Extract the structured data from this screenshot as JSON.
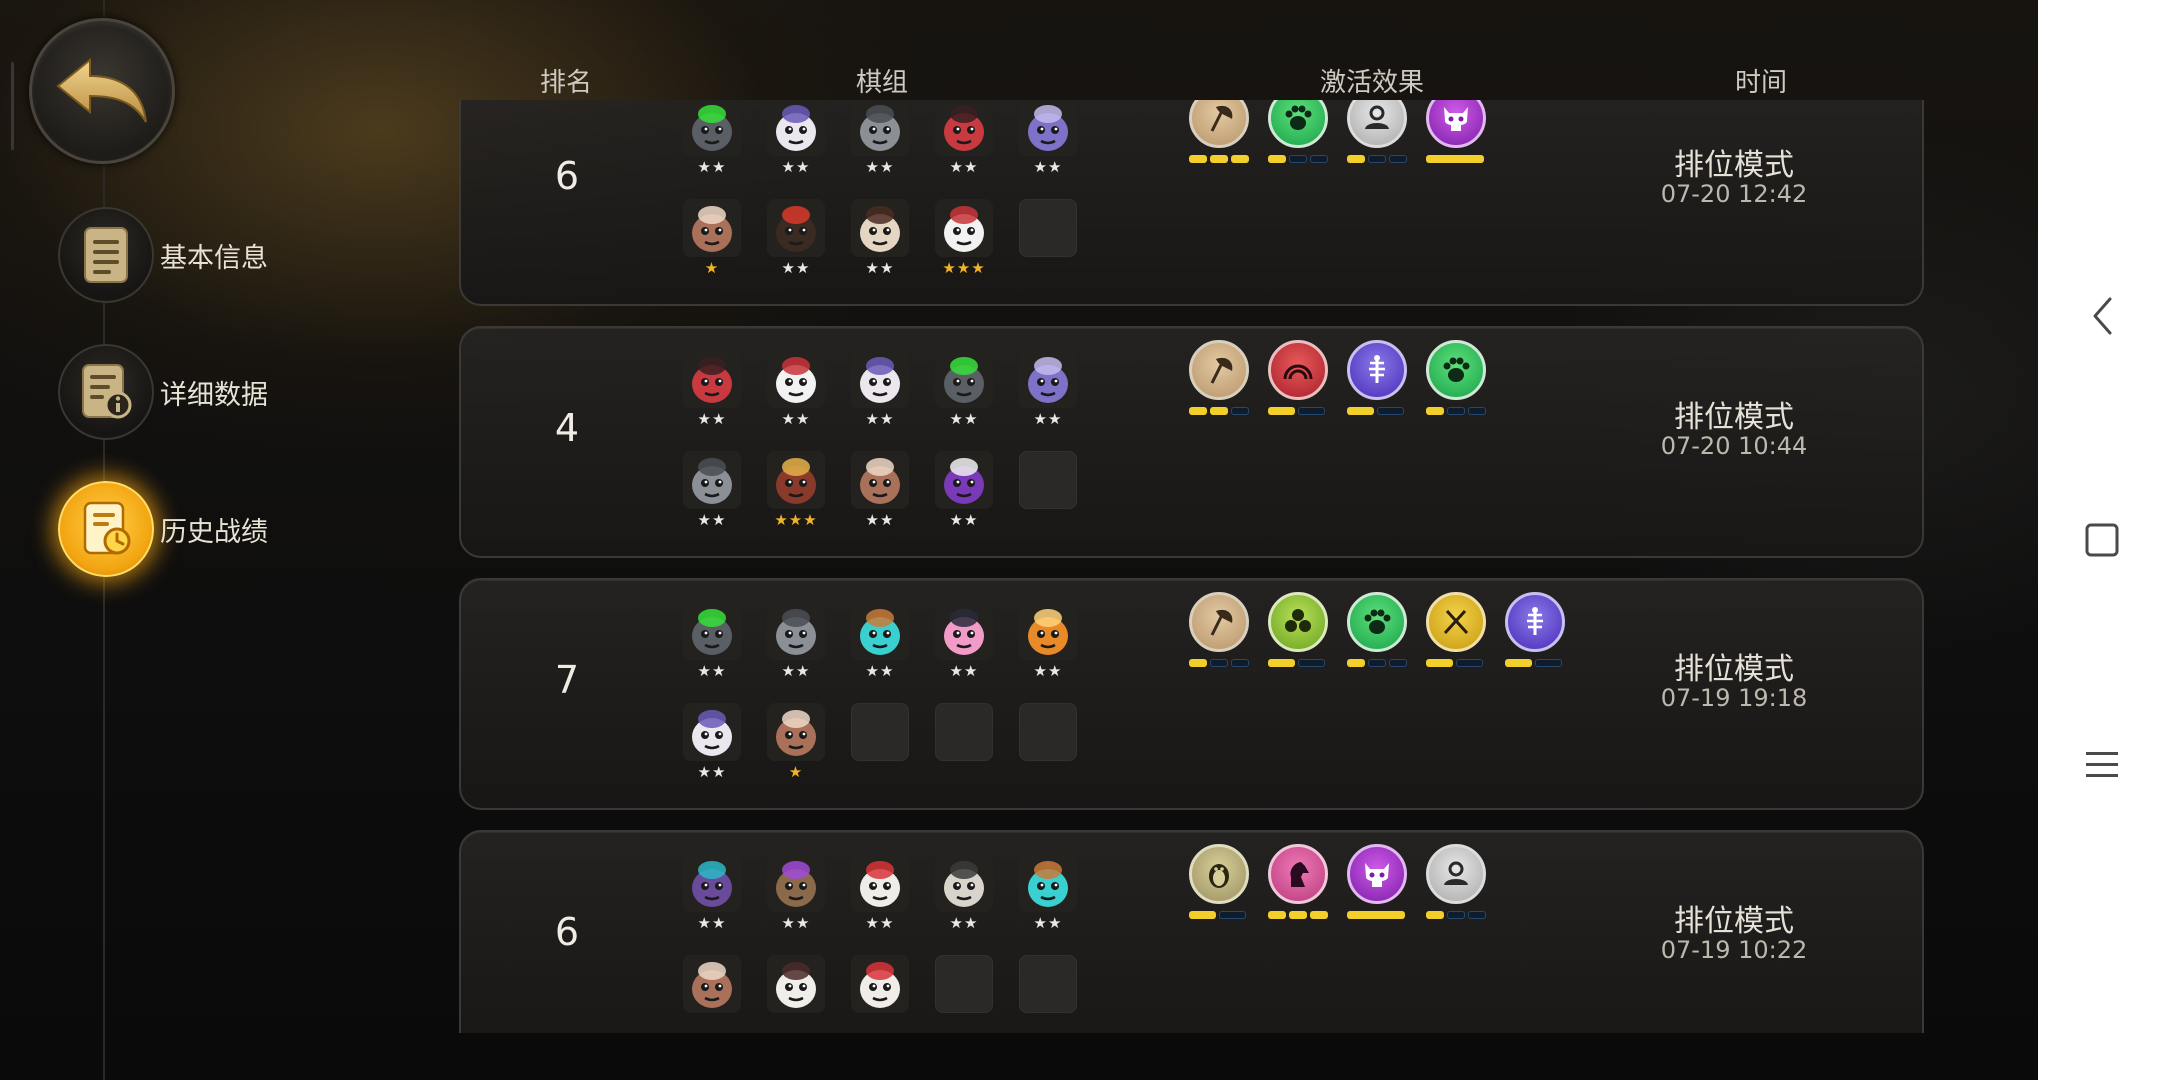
{
  "sidebar": {
    "back_icon": "curved-back-arrow-icon",
    "items": [
      {
        "label": "基本信息",
        "icon": "document-icon",
        "active": false
      },
      {
        "label": "详细数据",
        "icon": "info-document-icon",
        "active": false
      },
      {
        "label": "历史战绩",
        "icon": "history-clock-icon",
        "active": true
      }
    ]
  },
  "headers": {
    "rank": "排名",
    "pieces": "棋组",
    "effects": "激活效果",
    "time": "时间"
  },
  "colors": {
    "accent_gold": "#f5b21a",
    "bar_active": "#f2cf2a",
    "bar_inactive": "#27486c",
    "star_white": "#e8e8e8",
    "star_gold": "#f0b428"
  },
  "records": [
    {
      "rank": "6",
      "mode": "排位模式",
      "datetime": "07-20 12:42",
      "pieces": [
        {
          "icon": "robot-green-eye-icon",
          "stars": "★★",
          "star_color": "white"
        },
        {
          "icon": "goggles-pig-icon",
          "stars": "★★",
          "star_color": "white"
        },
        {
          "icon": "knight-helmet-icon",
          "stars": "★★",
          "star_color": "white"
        },
        {
          "icon": "red-ogre-icon",
          "stars": "★★",
          "star_color": "white"
        },
        {
          "icon": "purple-mech-icon",
          "stars": "★★",
          "star_color": "white"
        },
        {
          "icon": "brown-bear-icon",
          "stars": "★",
          "star_color": "gold"
        },
        {
          "icon": "red-hat-bandit-icon",
          "stars": "★★",
          "star_color": "white"
        },
        {
          "icon": "skull-mask-icon",
          "stars": "★★",
          "star_color": "white"
        },
        {
          "icon": "white-hair-ogre-icon",
          "stars": "★★★",
          "star_color": "gold"
        },
        {
          "icon": "empty-slot",
          "stars": "",
          "star_color": "white"
        }
      ],
      "traits": [
        {
          "icon": "axe-emblem-icon",
          "style": "bronze",
          "bars": [
            1,
            1,
            1
          ]
        },
        {
          "icon": "paw-emblem-icon",
          "style": "green",
          "bars": [
            1,
            0,
            0
          ]
        },
        {
          "icon": "guardian-emblem-icon",
          "style": "silver",
          "bars": [
            1,
            0,
            0
          ]
        },
        {
          "icon": "demon-skull-emblem-icon",
          "style": "purple",
          "bars": [
            1
          ]
        }
      ]
    },
    {
      "rank": "4",
      "mode": "排位模式",
      "datetime": "07-20 10:44",
      "pieces": [
        {
          "icon": "red-ogre-icon",
          "stars": "★★",
          "star_color": "white"
        },
        {
          "icon": "white-hair-ogre-icon",
          "stars": "★★",
          "star_color": "white"
        },
        {
          "icon": "goggles-pig-icon",
          "stars": "★★",
          "star_color": "white"
        },
        {
          "icon": "robot-green-eye-icon",
          "stars": "★★",
          "star_color": "white"
        },
        {
          "icon": "purple-mech-icon",
          "stars": "★★",
          "star_color": "white"
        },
        {
          "icon": "knight-helmet-icon",
          "stars": "★★",
          "star_color": "white"
        },
        {
          "icon": "horned-warrior-icon",
          "stars": "★★★",
          "star_color": "gold"
        },
        {
          "icon": "brown-bear-icon",
          "stars": "★★",
          "star_color": "white"
        },
        {
          "icon": "purple-witch-icon",
          "stars": "★★",
          "star_color": "white"
        },
        {
          "icon": "empty-slot",
          "stars": "",
          "star_color": "white"
        }
      ],
      "traits": [
        {
          "icon": "axe-emblem-icon",
          "style": "bronze",
          "bars": [
            1,
            1,
            0
          ]
        },
        {
          "icon": "rainbow-emblem-icon",
          "style": "red",
          "bars": [
            1,
            0
          ]
        },
        {
          "icon": "fishbone-emblem-icon",
          "style": "violet",
          "bars": [
            1,
            0
          ]
        },
        {
          "icon": "paw-emblem-icon",
          "style": "green",
          "bars": [
            1,
            0,
            0
          ]
        }
      ]
    },
    {
      "rank": "7",
      "mode": "排位模式",
      "datetime": "07-19 19:18",
      "pieces": [
        {
          "icon": "robot-green-eye-icon",
          "stars": "★★",
          "star_color": "white"
        },
        {
          "icon": "knight-helmet-icon",
          "stars": "★★",
          "star_color": "white"
        },
        {
          "icon": "cyan-robot-icon",
          "stars": "★★",
          "star_color": "white"
        },
        {
          "icon": "pink-hair-girl-icon",
          "stars": "★★",
          "star_color": "white"
        },
        {
          "icon": "orange-claw-icon",
          "stars": "★★",
          "star_color": "white"
        },
        {
          "icon": "goggles-pig-icon",
          "stars": "★★",
          "star_color": "white"
        },
        {
          "icon": "brown-bear-icon",
          "stars": "★",
          "star_color": "gold"
        },
        {
          "icon": "empty-slot",
          "stars": "",
          "star_color": "white"
        },
        {
          "icon": "empty-slot",
          "stars": "",
          "star_color": "white"
        },
        {
          "icon": "empty-slot",
          "stars": "",
          "star_color": "white"
        }
      ],
      "traits": [
        {
          "icon": "axe-emblem-icon",
          "style": "bronze",
          "bars": [
            1,
            0,
            0
          ]
        },
        {
          "icon": "clover-emblem-icon",
          "style": "lime",
          "bars": [
            1,
            0
          ]
        },
        {
          "icon": "paw-emblem-icon",
          "style": "green",
          "bars": [
            1,
            0,
            0
          ]
        },
        {
          "icon": "crossed-swords-emblem-icon",
          "style": "gold",
          "bars": [
            1,
            0
          ]
        },
        {
          "icon": "fishbone-emblem-icon",
          "style": "violet",
          "bars": [
            1,
            0
          ]
        }
      ]
    },
    {
      "rank": "6",
      "mode": "排位模式",
      "datetime": "07-19 10:22",
      "pieces": [
        {
          "icon": "purple-bat-icon",
          "stars": "★★",
          "star_color": "white"
        },
        {
          "icon": "visor-knight-icon",
          "stars": "★★",
          "star_color": "white"
        },
        {
          "icon": "red-eye-skull-icon",
          "stars": "★★",
          "star_color": "white"
        },
        {
          "icon": "samurai-icon",
          "stars": "★★",
          "star_color": "white"
        },
        {
          "icon": "cyan-robot-icon",
          "stars": "★★",
          "star_color": "white"
        },
        {
          "icon": "brown-bear-icon",
          "stars": "",
          "star_color": "white"
        },
        {
          "icon": "white-beast-icon",
          "stars": "",
          "star_color": "white"
        },
        {
          "icon": "red-eye-skull-icon",
          "stars": "",
          "star_color": "white"
        },
        {
          "icon": "empty-slot",
          "stars": "",
          "star_color": "white"
        },
        {
          "icon": "empty-slot",
          "stars": "",
          "star_color": "white"
        }
      ],
      "traits": [
        {
          "icon": "penguin-emblem-icon",
          "style": "olive",
          "bars": [
            1,
            0
          ]
        },
        {
          "icon": "knight-horse-emblem-icon",
          "style": "pink",
          "bars": [
            1,
            1,
            1
          ]
        },
        {
          "icon": "demon-skull-emblem-icon",
          "style": "purple",
          "bars": [
            1
          ]
        },
        {
          "icon": "guardian-emblem-icon",
          "style": "silver",
          "bars": [
            1,
            0,
            0
          ]
        }
      ]
    }
  ],
  "system_nav": [
    {
      "name": "back",
      "icon": "chevron-left-icon"
    },
    {
      "name": "home",
      "icon": "square-icon"
    },
    {
      "name": "menu",
      "icon": "hamburger-menu-icon"
    }
  ]
}
